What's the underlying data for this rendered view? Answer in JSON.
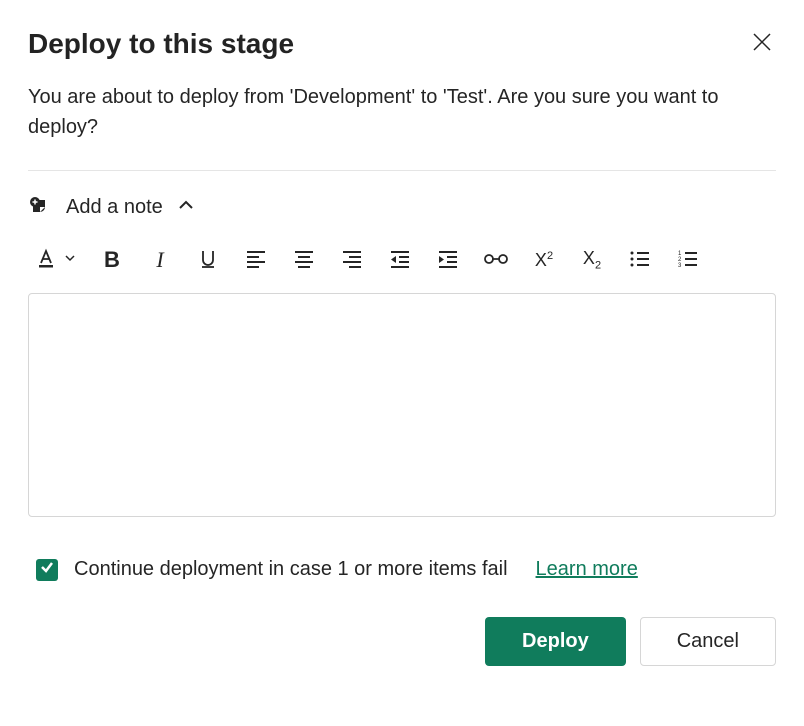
{
  "dialog": {
    "title": "Deploy to this stage",
    "subtitle": "You are about to deploy from 'Development' to 'Test'. Are you sure you want to deploy?"
  },
  "note": {
    "label": "Add a note",
    "content": "",
    "placeholder": ""
  },
  "toolbar": {
    "font_color": "Font color",
    "bold": "Bold",
    "italic": "Italic",
    "underline": "Underline",
    "align_left": "Align left",
    "align_center": "Align center",
    "align_right": "Align right",
    "indent_decrease": "Decrease indent",
    "indent_increase": "Increase indent",
    "link": "Insert link",
    "superscript": "Superscript",
    "subscript": "Subscript",
    "bulleted_list": "Bulleted list",
    "numbered_list": "Numbered list"
  },
  "checkbox": {
    "label": "Continue deployment in case 1 or more items fail",
    "checked": true,
    "learn_more": "Learn more"
  },
  "footer": {
    "deploy_label": "Deploy",
    "cancel_label": "Cancel"
  },
  "colors": {
    "primary": "#107c5c"
  }
}
